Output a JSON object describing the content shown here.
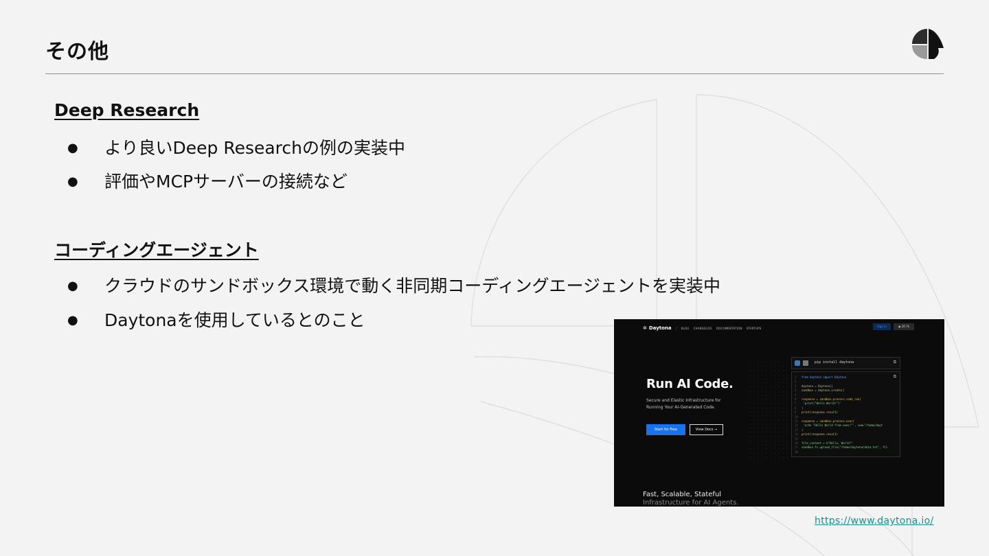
{
  "slide": {
    "title": "その他",
    "logo_icon": "leaf-logo-icon"
  },
  "sections": [
    {
      "heading": "Deep Research",
      "bullets": [
        "より良いDeep Researchの例の実装中",
        "評価やMCPサーバーの接続など"
      ]
    },
    {
      "heading": "コーディングエージェント",
      "bullets": [
        "クラウドのサンドボックス環境で動く非同期コーディングエージェントを実装中",
        "Daytonaを使用しているとのこと"
      ]
    }
  ],
  "bullet_glyph": "●",
  "screenshot": {
    "brand": "Daytona",
    "nav_links": [
      "BLOG",
      "CHANGELOG",
      "DOCUMENTATION",
      "STARTUPS"
    ],
    "sign_in": "Sign in",
    "github_stars": "20.7k",
    "hero_title": "Run AI Code.",
    "hero_subtitle_line1": "Secure and Elastic Infrastructure for",
    "hero_subtitle_line2": "Running Your AI-Generated Code.",
    "primary_button": "Start for Free",
    "secondary_button": "View Docs →",
    "install_command": "pip install daytona",
    "code_lines": [
      "from daytona import Daytona",
      "",
      "daytona = Daytona()",
      "sandbox = daytona.create()",
      "",
      "response = sandbox.process.code_run(",
      "  'print(\"Hello World!\")'",
      ")",
      "print(response.result)",
      "",
      "response = sandbox.process.exec(",
      "  'echo \"Hello World from exec!\"', cwd=\"/home/dayt",
      ")",
      "print(response.result)",
      "",
      "file_content = b\"Hello, World!\"",
      "sandbox.fs.upload_file(\"/home/daytona/data.txt\", fil",
      ""
    ],
    "footer_line1": "Fast, Scalable, Stateful",
    "footer_line2": "Infrastructure for AI Agents."
  },
  "source_link": "https://www.daytona.io/",
  "colors": {
    "background": "#f3f3f3",
    "link": "#1a8f8f",
    "accent_blue": "#1773f0"
  }
}
